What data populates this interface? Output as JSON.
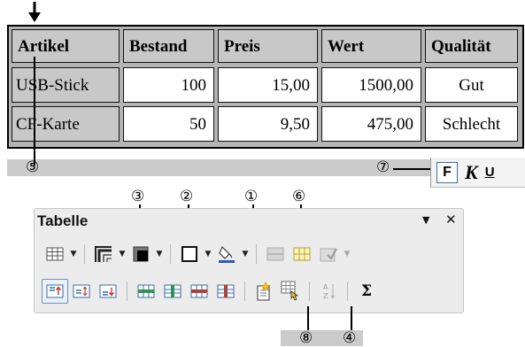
{
  "table": {
    "headers": [
      "Artikel",
      "Bestand",
      "Preis",
      "Wert",
      "Qualität"
    ],
    "rows": [
      [
        "USB-Stick",
        "100",
        "15,00",
        "1500,00",
        "Gut"
      ],
      [
        "CF-Karte",
        "50",
        "9,50",
        "475,00",
        "Schlecht"
      ]
    ]
  },
  "callouts": {
    "c1": "①",
    "c2": "②",
    "c3": "③",
    "c4": "④",
    "c5": "⑤",
    "c6": "⑥",
    "c7": "⑦",
    "c8": "⑧"
  },
  "format_toolbar": {
    "bold": "F",
    "italic": "K",
    "underline": "U"
  },
  "panel": {
    "title": "Tabelle",
    "menu_glyph": "▼",
    "close_glyph": "✕",
    "sum_glyph": "Σ"
  },
  "icons": [
    "table-insert-icon",
    "border-style-icon",
    "line-color-icon",
    "borders-icon",
    "background-fill-icon",
    "merge-cells-icon",
    "split-cells-icon",
    "optimize-icon",
    "align-top-icon",
    "align-center-icon",
    "align-bottom-icon",
    "insert-row-icon",
    "insert-column-icon",
    "delete-row-icon",
    "delete-column-icon",
    "autoformat-icon",
    "table-properties-icon",
    "sort-icon",
    "sum-icon"
  ],
  "colors": {
    "header_bg": "#c8c8c8",
    "toolbar_bg": "#ececec",
    "selected_border": "#6f8fb8",
    "accent_green": "#2e9a4a",
    "accent_red": "#c0392b"
  }
}
